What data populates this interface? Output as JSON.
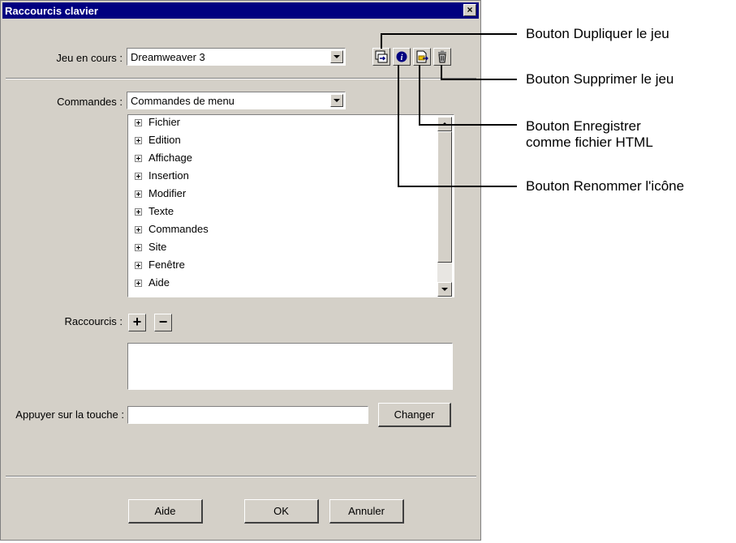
{
  "window": {
    "title": "Raccourcis clavier",
    "close_label": "×"
  },
  "current_set": {
    "label": "Jeu en cours :",
    "value": "Dreamweaver 3"
  },
  "commands": {
    "label": "Commandes :",
    "value": "Commandes de menu",
    "items": [
      "Fichier",
      "Edition",
      "Affichage",
      "Insertion",
      "Modifier",
      "Texte",
      "Commandes",
      "Site",
      "Fenêtre",
      "Aide"
    ]
  },
  "shortcuts": {
    "label": "Raccourcis :",
    "add_label": "+",
    "remove_label": "−"
  },
  "key_input": {
    "label": "Appuyer sur la touche :",
    "value": "",
    "change_label": "Changer"
  },
  "footer": {
    "help_label": "Aide",
    "ok_label": "OK",
    "cancel_label": "Annuler"
  },
  "callouts": {
    "duplicate": "Bouton Dupliquer le jeu",
    "delete": "Bouton Supprimer le jeu",
    "export_line1": "Bouton Enregistrer",
    "export_line2": "comme fichier HTML",
    "rename": "Bouton Renommer l'icône"
  },
  "icons": [
    "duplicate-set-icon",
    "rename-set-icon",
    "export-html-icon",
    "delete-set-icon"
  ],
  "colors": {
    "titlebar": "#000080",
    "dialog_bg": "#d4d0c8"
  }
}
